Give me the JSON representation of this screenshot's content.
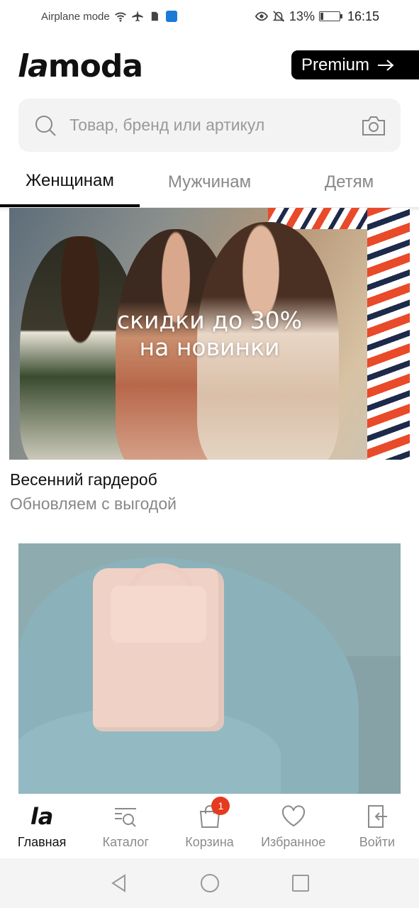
{
  "status_bar": {
    "airplane_label": "Airplane mode",
    "battery_percent": "13%",
    "battery_level": 0.13,
    "time": "16:15",
    "icons": [
      "wifi-icon",
      "airplane-icon",
      "sim-icon",
      "app-notification-icon",
      "eye-icon",
      "bell-off-icon",
      "battery-icon"
    ]
  },
  "header": {
    "logo_la": "la",
    "logo_moda": "moda",
    "premium_label": "Premium"
  },
  "search": {
    "placeholder": "Товар, бренд или артикул"
  },
  "tabs": [
    {
      "label": "Женщинам",
      "active": true
    },
    {
      "label": "Мужчинам",
      "active": false
    },
    {
      "label": "Детям",
      "active": false
    }
  ],
  "promo": {
    "banner_line1": "скидки до 30%",
    "banner_line2": "на новинки",
    "title": "Весенний гардероб",
    "subtitle": "Обновляем с выгодой"
  },
  "bottom_nav": [
    {
      "label": "Главная",
      "icon": "lamoda-home-icon",
      "active": true
    },
    {
      "label": "Каталог",
      "icon": "catalog-search-icon",
      "active": false
    },
    {
      "label": "Корзина",
      "icon": "cart-bag-icon",
      "active": false,
      "badge": "1"
    },
    {
      "label": "Избранное",
      "icon": "heart-icon",
      "active": false
    },
    {
      "label": "Войти",
      "icon": "login-icon",
      "active": false
    }
  ],
  "nav_home_logo": "la",
  "colors": {
    "accent_black": "#000000",
    "badge_red": "#e53a1f",
    "inactive_gray": "#8a8a8a"
  }
}
